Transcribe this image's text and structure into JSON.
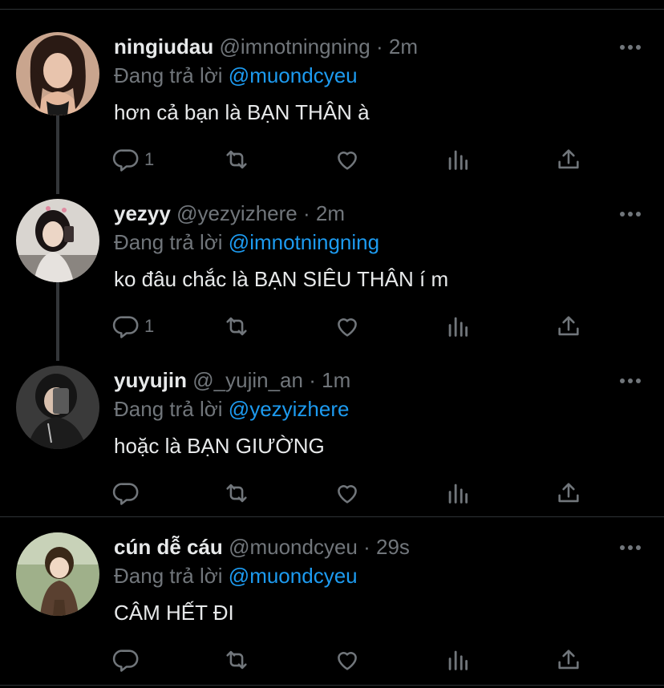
{
  "tweets": [
    {
      "name": "ningiudau",
      "handle": "@imnotningning",
      "time": "2m",
      "reply_prefix": "Đang trả lời",
      "reply_to": "@muondcyeu",
      "text": "hơn cả bạn là BẠN THÂN à",
      "reply_count": "1"
    },
    {
      "name": "yezyy",
      "handle": "@yezyizhere",
      "time": "2m",
      "reply_prefix": "Đang trả lời",
      "reply_to": "@imnotningning",
      "text": "ko đâu chắc là BẠN SIÊU THÂN í m",
      "reply_count": "1"
    },
    {
      "name": "yuyujin",
      "handle": "@_yujin_an",
      "time": "1m",
      "reply_prefix": "Đang trả lời",
      "reply_to": "@yezyizhere",
      "text": "hoặc là BẠN GIƯỜNG",
      "reply_count": ""
    },
    {
      "name": "cún dễ cáu",
      "handle": "@muondcyeu",
      "time": "29s",
      "reply_prefix": "Đang trả lời",
      "reply_to": "@muondcyeu",
      "text": "CÂM HẾT ĐI",
      "reply_count": ""
    }
  ],
  "separator": "·",
  "colors": {
    "background": "#000000",
    "muted": "#71767b",
    "mention": "#1d9bf0",
    "text": "#e7e9ea"
  },
  "icons": [
    "reply-icon",
    "retweet-icon",
    "like-icon",
    "views-icon",
    "share-icon",
    "more-icon"
  ]
}
